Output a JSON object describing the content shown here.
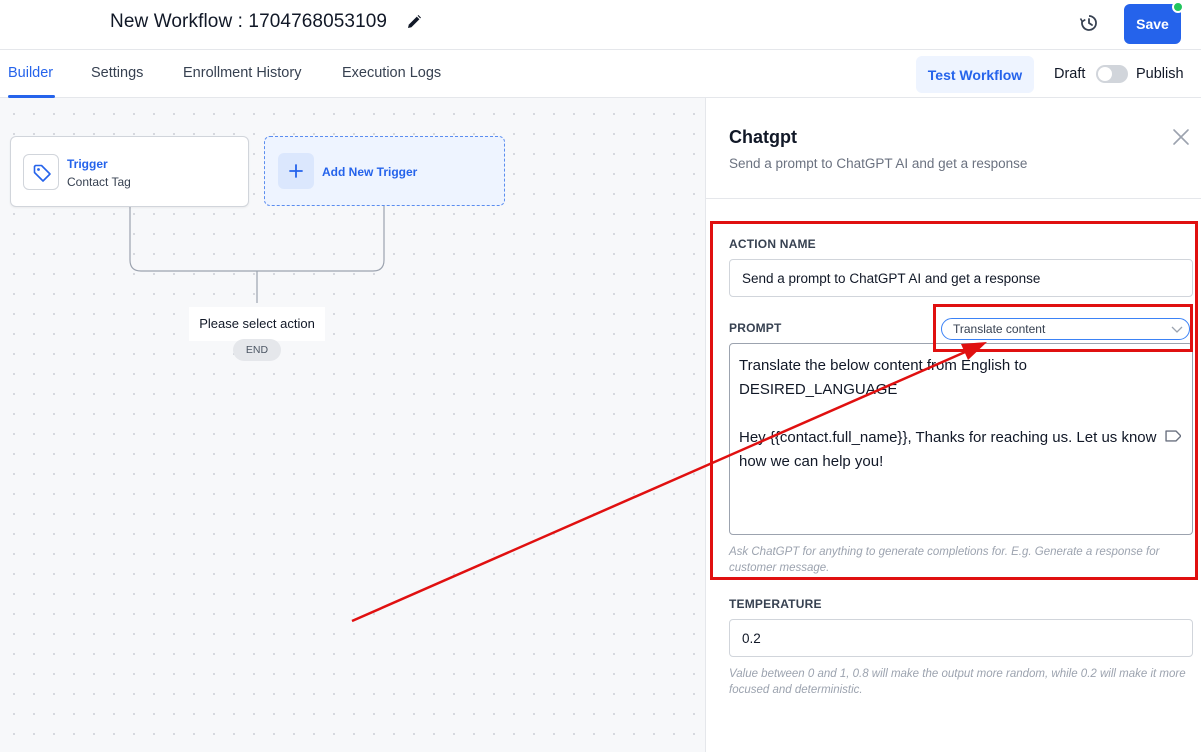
{
  "header": {
    "workflow_title": "New Workflow : 1704768053109",
    "save_label": "Save"
  },
  "tabs": [
    {
      "label": "Builder",
      "active": true
    },
    {
      "label": "Settings",
      "active": false
    },
    {
      "label": "Enrollment History",
      "active": false
    },
    {
      "label": "Execution Logs",
      "active": false
    }
  ],
  "toolbar": {
    "test_label": "Test Workflow",
    "draft_label": "Draft",
    "publish_label": "Publish",
    "published": false
  },
  "canvas": {
    "trigger_title": "Trigger",
    "trigger_subtitle": "Contact Tag",
    "add_trigger_label": "Add New Trigger",
    "select_action_label": "Please select action",
    "end_label": "END"
  },
  "panel": {
    "title": "Chatgpt",
    "subtitle": "Send a prompt to ChatGPT AI and get a response",
    "action_name_label": "ACTION NAME",
    "action_name_value": "Send a prompt to ChatGPT AI and get a response",
    "prompt_label": "PROMPT",
    "prompt_template_value": "Translate content",
    "prompt_text": "Translate the below content from English to\nDESIRED_LANGUAGE\n\nHey {{contact.full_name}}, Thanks for reaching us. Let us know\nhow we can help you!",
    "prompt_hint": "Ask ChatGPT for anything to generate completions for. E.g. Generate a response for customer message.",
    "temperature_label": "TEMPERATURE",
    "temperature_value": "0.2",
    "temperature_hint": "Value between 0 and 1, 0.8 will make the output more random, while 0.2 will make it more focused and deterministic."
  },
  "colors": {
    "accent": "#2563eb",
    "annotation": "#e01010",
    "status_dot": "#22c55e"
  }
}
